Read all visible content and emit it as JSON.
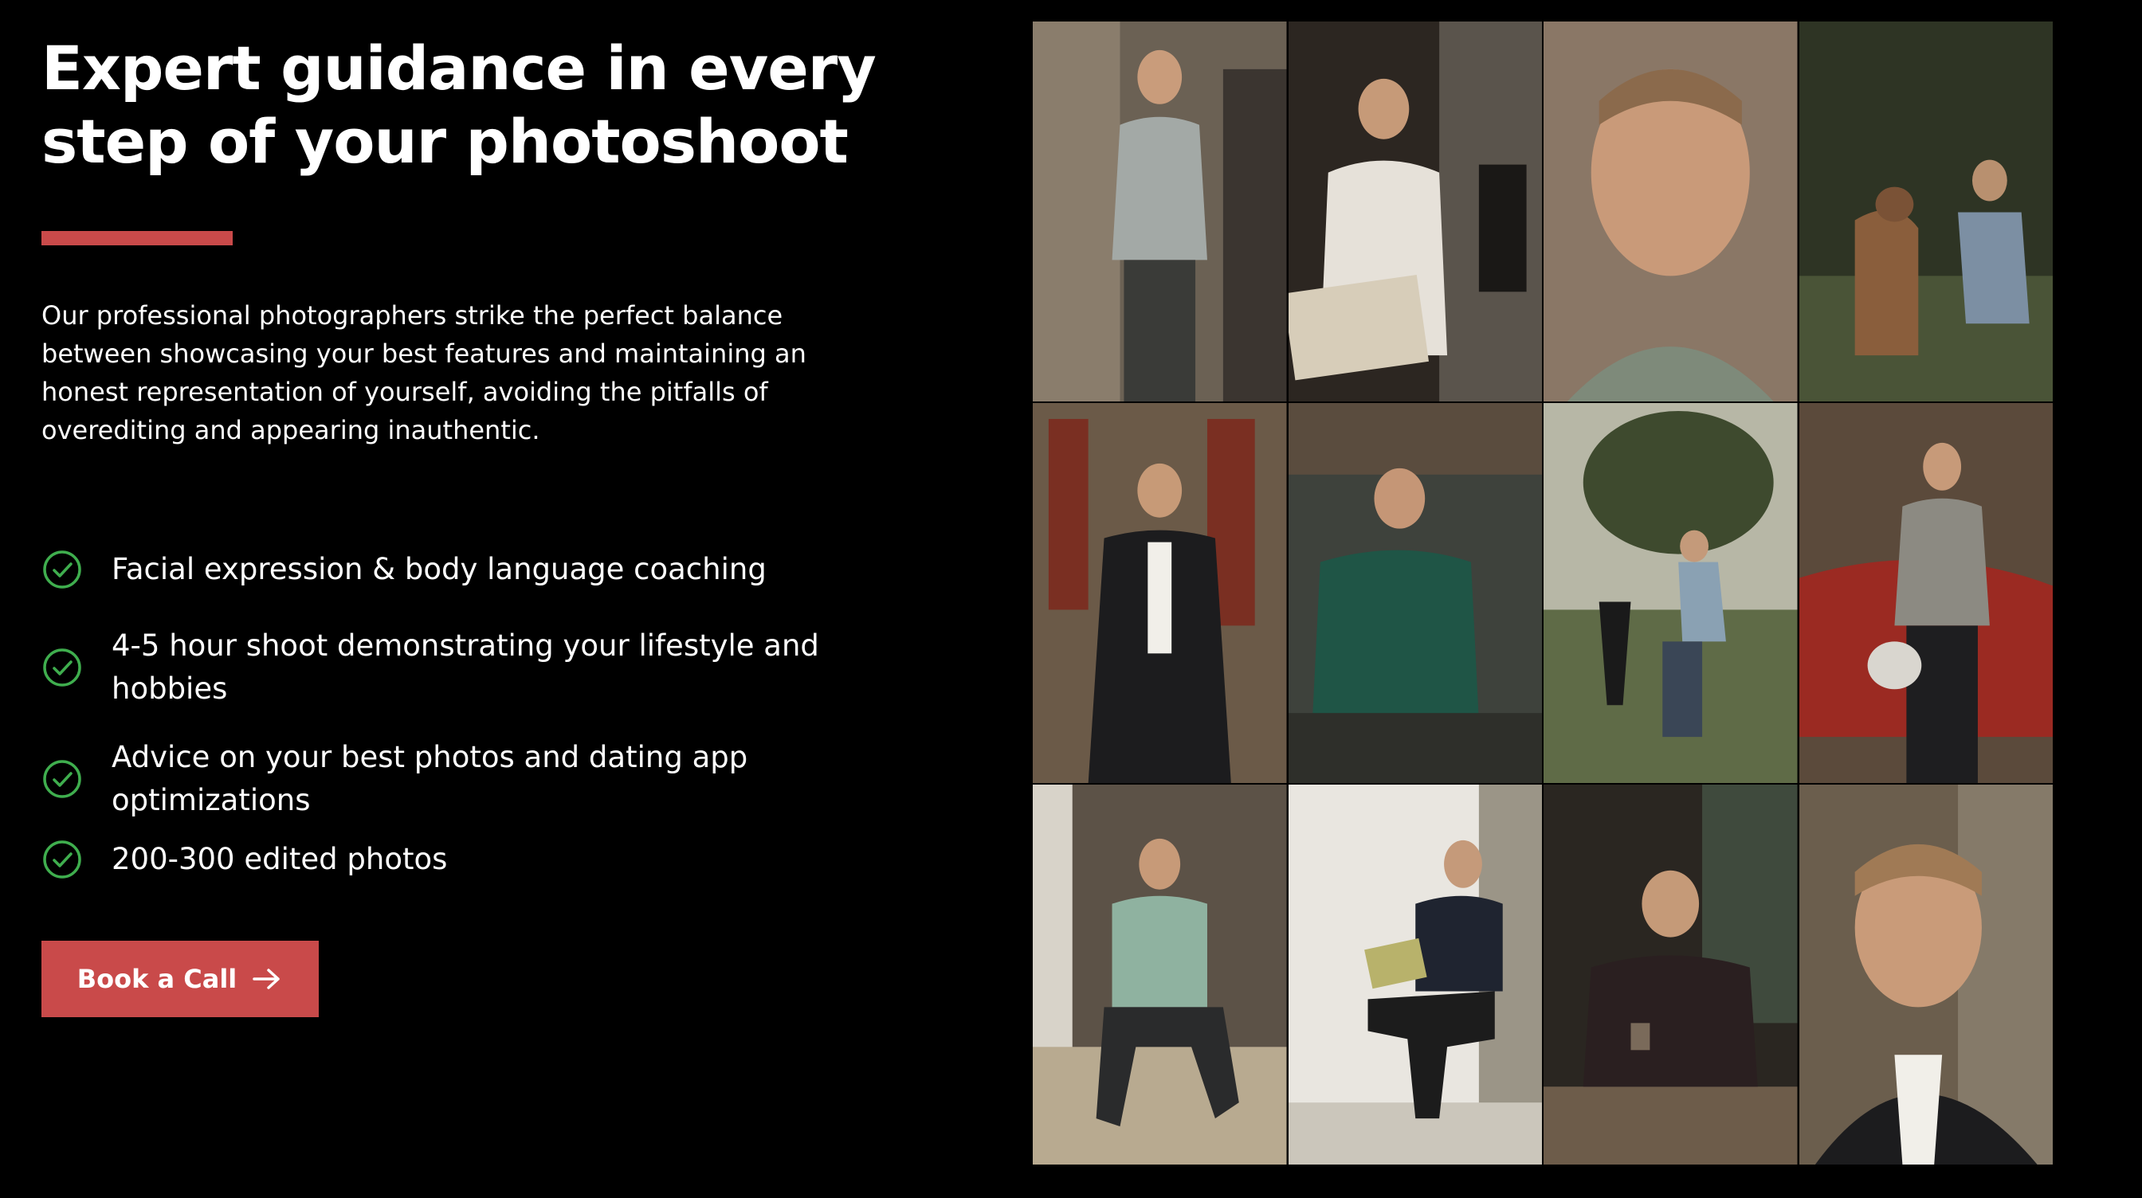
{
  "headline": "Expert guidance in every step of your photoshoot",
  "intro": "Our professional photographers strike the perfect balance between showcasing your best features and maintaining an honest representation of yourself, avoiding the pitfalls of overediting and appearing inauthentic.",
  "features": [
    "Facial expression & body language coaching",
    "4-5 hour shoot demonstrating your lifestyle and hobbies",
    "Advice on your best photos and dating app optimizations",
    "200-300 edited photos"
  ],
  "cta": {
    "label": "Book a Call",
    "icon": "arrow-right-icon"
  },
  "colors": {
    "background": "#000000",
    "accent": "#c94a4a",
    "check": "#3fae4e",
    "text": "#ffffff"
  },
  "icons": {
    "feature_icon": "check-circle-icon"
  }
}
